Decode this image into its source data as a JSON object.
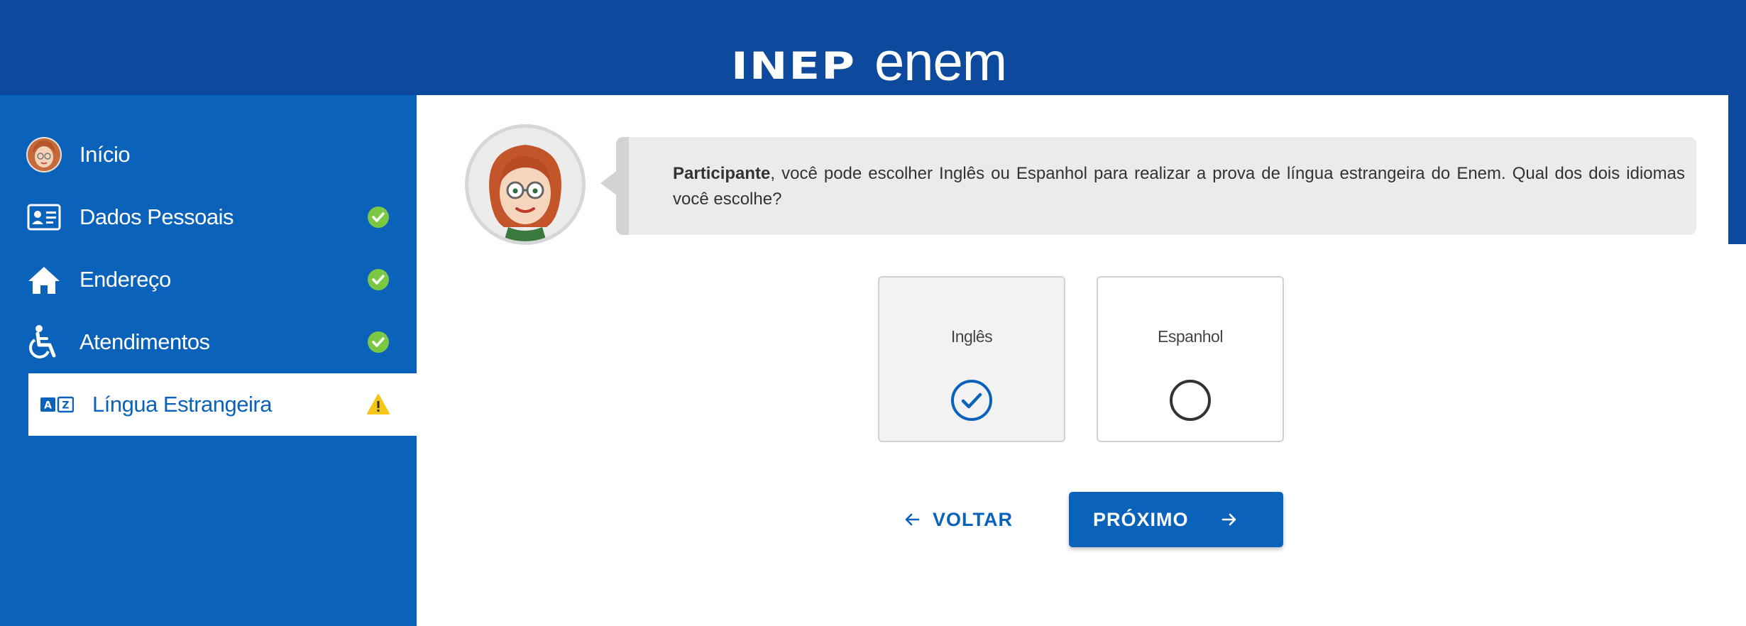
{
  "header": {
    "logo_inep": "INEP",
    "logo_enem": "enem"
  },
  "sidebar": {
    "items": [
      {
        "label": "Início",
        "icon": "avatar-icon",
        "status": null
      },
      {
        "label": "Dados Pessoais",
        "icon": "id-card-icon",
        "status": "complete"
      },
      {
        "label": "Endereço",
        "icon": "home-icon",
        "status": "complete"
      },
      {
        "label": "Atendimentos",
        "icon": "wheelchair-icon",
        "status": "complete"
      },
      {
        "label": "Língua Estrangeira",
        "icon": "language-az-icon",
        "status": "warning",
        "active": true
      }
    ]
  },
  "message": {
    "bold": "Participante",
    "text": ", você pode escolher Inglês ou Espanhol para realizar a prova de língua estrangeira do Enem. Qual dos dois idiomas você escolhe?"
  },
  "options": [
    {
      "label": "Inglês",
      "selected": true
    },
    {
      "label": "Espanhol",
      "selected": false
    }
  ],
  "actions": {
    "back_label": "VOLTAR",
    "next_label": "PRÓXIMO"
  },
  "colors": {
    "header": "#0d4a9e",
    "sidebar": "#0b62bb",
    "primary": "#0b62bb",
    "success": "#7ac943",
    "warning": "#f5c518"
  }
}
